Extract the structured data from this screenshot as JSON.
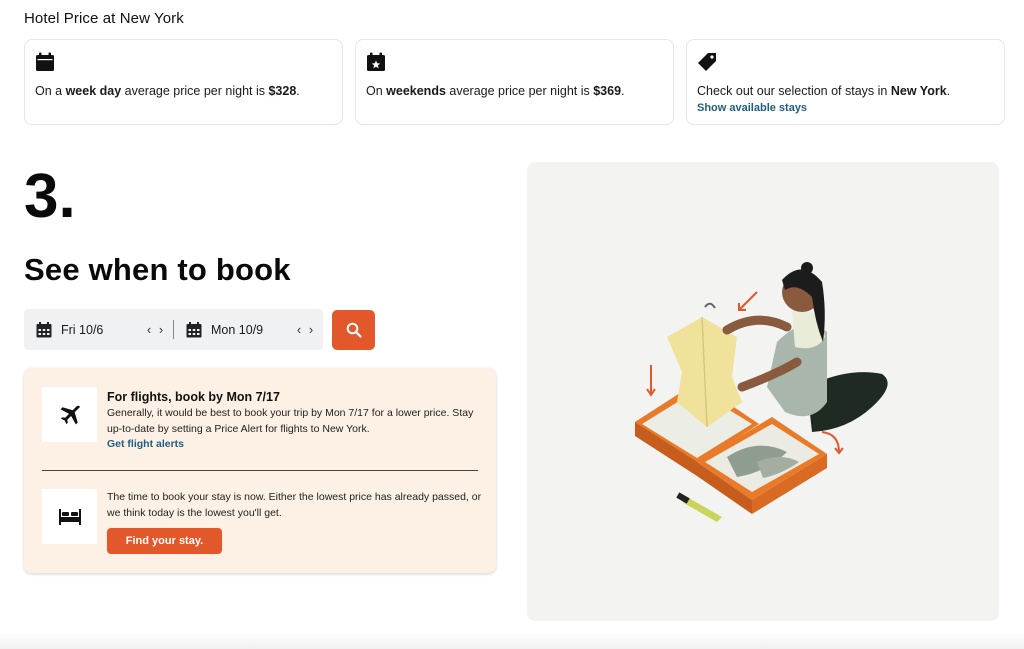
{
  "header": {
    "title": "Hotel Price at New York"
  },
  "cards": [
    {
      "icon": "calendar-icon",
      "pre": "On a ",
      "bold1": "week day",
      "mid": " average price per night is ",
      "bold2": "$328",
      "post": "."
    },
    {
      "icon": "calendar-star-icon",
      "pre": "On ",
      "bold1": "weekends",
      "mid": " average price per night is ",
      "bold2": "$369",
      "post": "."
    },
    {
      "icon": "tag-icon",
      "pre": "Check out our selection of stays in ",
      "bold1": "New York",
      "post": ".",
      "link": "Show available stays"
    }
  ],
  "step": {
    "number": "3.",
    "heading": "See when to book"
  },
  "dates": {
    "start": "Fri 10/6",
    "end": "Mon 10/9",
    "prev_arrow": "‹",
    "next_arrow": "›"
  },
  "advice": {
    "flight": {
      "title": "For flights, book by Mon 7/17",
      "body": "Generally, it would be best to book your trip by Mon 7/17 for a lower price. Stay up-to-date by setting a Price Alert for flights to New York.",
      "link": "Get flight alerts"
    },
    "stay": {
      "body": "The time to book your stay is now. Either the lowest price has already passed, or we think today is the lowest you'll get.",
      "button": "Find your stay."
    }
  },
  "colors": {
    "accent": "#e2582b",
    "link": "#1f5e84",
    "panel": "#fdf0e4",
    "illustration_bg": "#f3f4f2"
  }
}
